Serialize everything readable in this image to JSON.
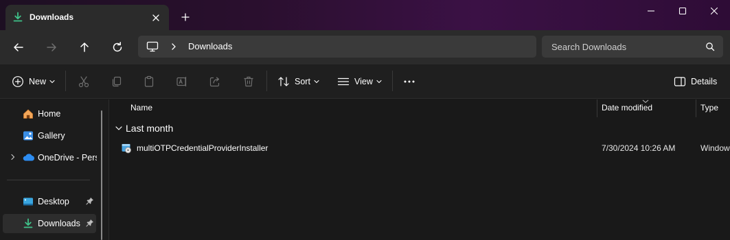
{
  "window": {
    "tab_title": "Downloads",
    "tab_icon": "download-icon",
    "controls": [
      "minimize-icon",
      "maximize-icon",
      "close-icon"
    ]
  },
  "nav": {
    "buttons": [
      "back-arrow-icon",
      "forward-arrow-icon",
      "up-arrow-icon",
      "refresh-icon"
    ],
    "breadcrumb": [
      "Downloads"
    ],
    "search_placeholder": "Search Downloads"
  },
  "command_bar": {
    "new_label": "New",
    "sort_label": "Sort",
    "view_label": "View",
    "details_label": "Details",
    "icons": [
      "cut-icon",
      "copy-icon",
      "paste-icon",
      "rename-icon",
      "share-icon",
      "delete-icon",
      "more-icon"
    ]
  },
  "sidebar": {
    "items": [
      {
        "label": "Home",
        "icon": "home-icon"
      },
      {
        "label": "Gallery",
        "icon": "gallery-icon"
      },
      {
        "label": "OneDrive - Personal",
        "icon": "onedrive-icon"
      },
      {
        "label": "Desktop",
        "icon": "desktop-icon",
        "pinned": true
      },
      {
        "label": "Downloads",
        "icon": "download-icon",
        "pinned": true,
        "selected": true
      }
    ]
  },
  "file_list": {
    "columns": [
      "Name",
      "Date modified",
      "Type"
    ],
    "groups": [
      {
        "label": "Last month",
        "files": [
          {
            "name": "multiOTPCredentialProviderInstaller",
            "date_modified": "7/30/2024 10:26 AM",
            "type": "Windows Installer Package",
            "icon": "installer-icon"
          }
        ]
      }
    ]
  },
  "colors": {
    "accent": "#4cc2ff",
    "download_green": "#3fc38a",
    "titlebar_purple": "#3b1145"
  }
}
